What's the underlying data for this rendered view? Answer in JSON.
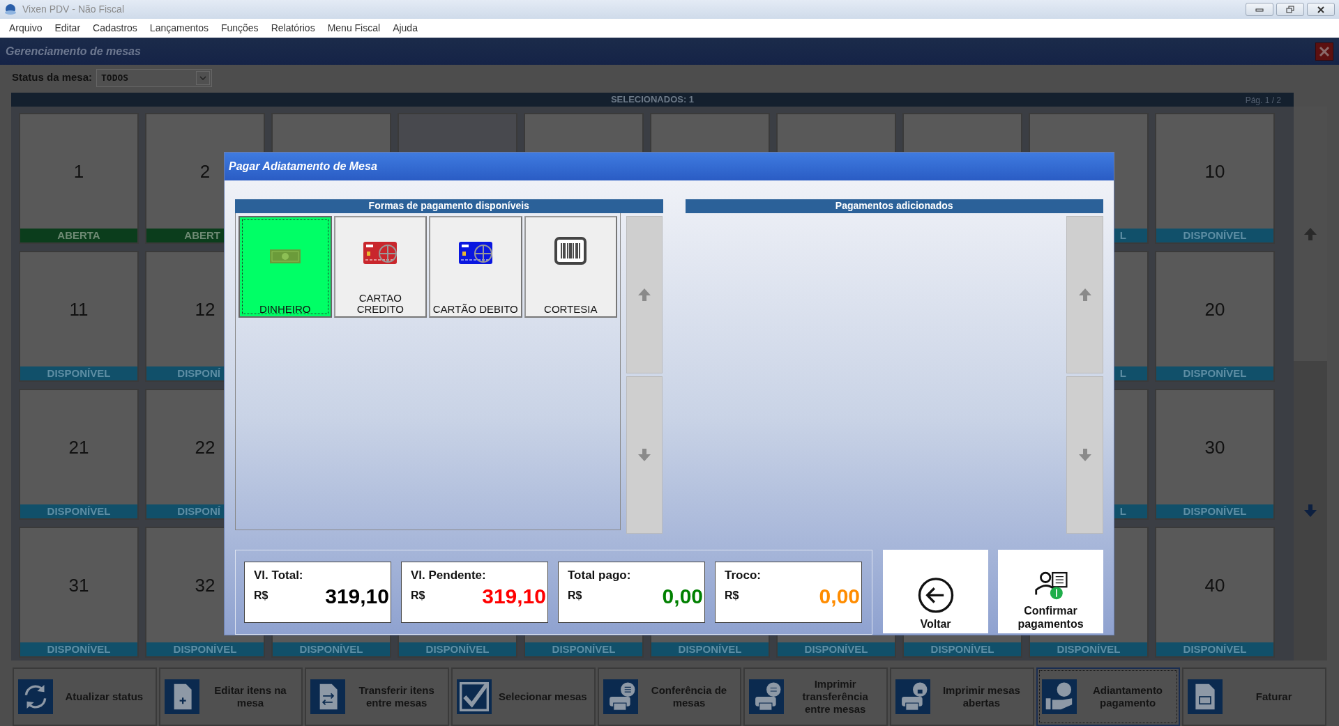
{
  "window": {
    "title": "Vixen PDV - Não Fiscal"
  },
  "menu": [
    "Arquivo",
    "Editar",
    "Cadastros",
    "Lançamentos",
    "Funções",
    "Relatórios",
    "Menu Fiscal",
    "Ajuda"
  ],
  "panel": {
    "title": "Gerenciamento de mesas",
    "status_filter": {
      "label": "Status da mesa:",
      "value": "TODOS"
    },
    "selection_bar": {
      "text": "SELECIONADOS: 1",
      "page": "Pág. 1 / 2"
    },
    "table_rows": [
      [
        {
          "number": "1",
          "status": "ABERTA",
          "kind": "open",
          "selected": false
        },
        {
          "number": "2",
          "status": "ABERT",
          "kind": "open",
          "selected": false
        },
        {
          "selected": false
        },
        {
          "selected": true
        },
        {
          "selected": false
        },
        {
          "selected": false
        },
        {
          "selected": false
        },
        {
          "selected": false
        },
        {
          "status": "L",
          "kind": "free",
          "selected": false
        },
        {
          "number": "10",
          "status": "DISPONÍVEL",
          "kind": "free",
          "selected": false
        }
      ],
      [
        {
          "number": "11",
          "status": "DISPONÍVEL",
          "kind": "free",
          "selected": false
        },
        {
          "number": "12",
          "status": "DISPONÍ",
          "kind": "free",
          "selected": false
        },
        {
          "status": "L",
          "kind": "free",
          "selected": false
        },
        {
          "number": "20",
          "status": "DISPONÍVEL",
          "kind": "free",
          "selected": false
        }
      ],
      [
        {
          "number": "21",
          "status": "DISPONÍVEL",
          "kind": "free",
          "selected": false
        },
        {
          "number": "22",
          "status": "DISPONÍ",
          "kind": "free",
          "selected": false
        },
        {
          "status": "L",
          "kind": "free",
          "selected": false
        },
        {
          "number": "30",
          "status": "DISPONÍVEL",
          "kind": "free",
          "selected": false
        }
      ],
      [
        {
          "number": "31",
          "status": "DISPONÍVEL",
          "kind": "free",
          "selected": false
        },
        {
          "number": "32",
          "status": "DISPONÍVEL",
          "kind": "free",
          "selected": false
        },
        {
          "status": "DISPONÍVEL",
          "kind": "free"
        },
        {
          "status": "DISPONÍVEL",
          "kind": "free"
        },
        {
          "status": "DISPONÍVEL",
          "kind": "free"
        },
        {
          "status": "DISPONÍVEL",
          "kind": "free"
        },
        {
          "status": "DISPONÍVEL",
          "kind": "free"
        },
        {
          "status": "DISPONÍVEL",
          "kind": "free"
        },
        {
          "status": "DISPONÍVEL",
          "kind": "free",
          "selected": false
        },
        {
          "number": "40",
          "status": "DISPONÍVEL",
          "kind": "free",
          "selected": false
        }
      ]
    ]
  },
  "dialog": {
    "title": "Pagar Adiatamento de Mesa",
    "available": {
      "header": "Formas de pagamento disponíveis",
      "methods": [
        {
          "label": "DINHEIRO",
          "selected": true
        },
        {
          "label": "CARTAO CREDITO",
          "selected": false
        },
        {
          "label": "CARTÃO DEBITO",
          "selected": false
        },
        {
          "label": "CORTESIA",
          "selected": false
        }
      ]
    },
    "added": {
      "header": "Pagamentos adicionados"
    },
    "totals": [
      {
        "label": "Vl. Total:",
        "currency": "R$",
        "value": "319,10",
        "color": "#000000"
      },
      {
        "label": "Vl. Pendente:",
        "currency": "R$",
        "value": "319,10",
        "color": "#ff0000"
      },
      {
        "label": "Total pago:",
        "currency": "R$",
        "value": "0,00",
        "color": "#008000"
      },
      {
        "label": "Troco:",
        "currency": "R$",
        "value": "0,00",
        "color": "#ff8c00"
      }
    ],
    "buttons": [
      "Voltar",
      "Confirmar pagamentos"
    ]
  },
  "toolbar": [
    {
      "label": "Atualizar status",
      "focused": false
    },
    {
      "label": "Editar itens na mesa",
      "focused": false
    },
    {
      "label": "Transferir itens entre mesas",
      "focused": false
    },
    {
      "label": "Selecionar mesas",
      "focused": false
    },
    {
      "label": "Conferência de mesas",
      "focused": false
    },
    {
      "label": "Imprimir transferência entre mesas",
      "focused": false
    },
    {
      "label": "Imprimir mesas abertas",
      "focused": false
    },
    {
      "label": "Adiantamento pagamento",
      "focused": true
    },
    {
      "label": "Faturar",
      "focused": false
    }
  ]
}
